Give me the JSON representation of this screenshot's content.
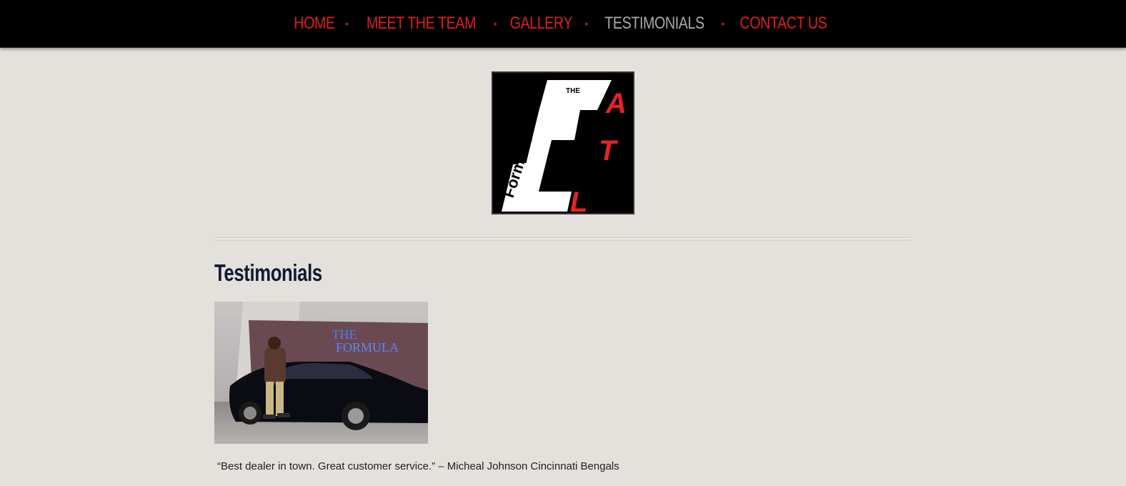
{
  "nav": {
    "items": [
      {
        "label": "HOME",
        "active": false
      },
      {
        "label": "MEET THE TEAM",
        "active": false
      },
      {
        "label": "GALLERY",
        "active": false
      },
      {
        "label": "TESTIMONIALS",
        "active": true
      },
      {
        "label": "CONTACT US",
        "active": false
      }
    ],
    "separator": "•"
  },
  "logo": {
    "the": "THE",
    "formula": "Formula",
    "atl": "ATL"
  },
  "page": {
    "title": "Testimonials"
  },
  "photo": {
    "sign_line1": "THE",
    "sign_line2": "FORMULA"
  },
  "testimonial": {
    "quote": "“Best dealer in town. Great customer service.” – Micheal Johnson Cincinnati Bengals"
  },
  "colors": {
    "accent": "#d8221f",
    "nav_bg": "#000000",
    "nav_active": "#a9a9a9",
    "page_bg": "#e4e1dc",
    "title": "#131a30"
  }
}
